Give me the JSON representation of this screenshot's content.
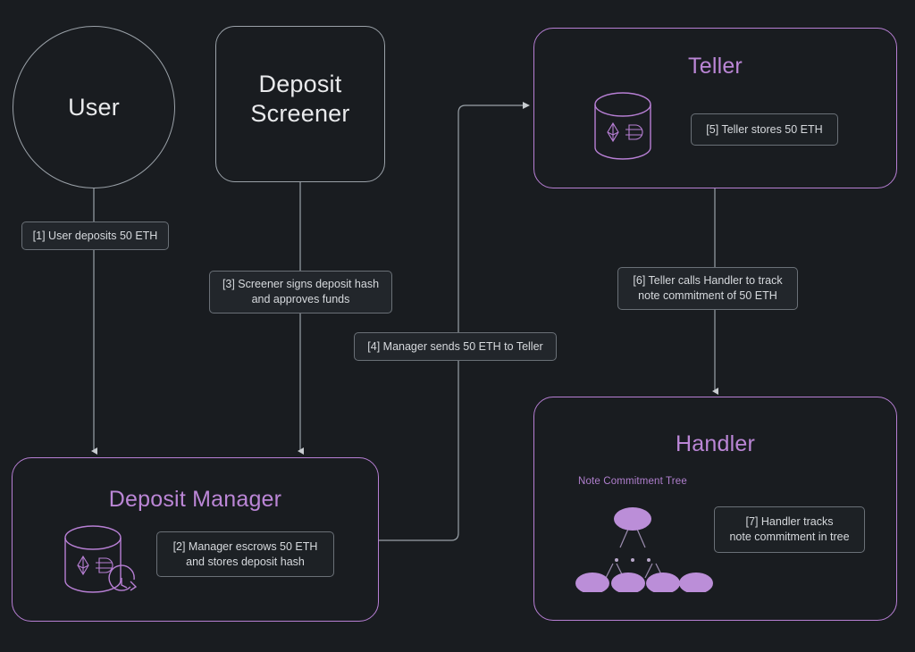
{
  "diagram": {
    "background_color": "#191c20",
    "accent_purple": "#b77fd4",
    "title_purple": "#bb86d6",
    "grey_stroke": "#9aa1a8",
    "nodes": [
      {
        "id": "user",
        "label": "User",
        "shape": "circle",
        "style": "grey"
      },
      {
        "id": "deposit-screener",
        "label": "Deposit\nScreener",
        "shape": "rounded-rect",
        "style": "grey"
      },
      {
        "id": "teller",
        "label": "Teller",
        "shape": "rounded-rect",
        "style": "purple"
      },
      {
        "id": "deposit-manager",
        "label": "Deposit Manager",
        "shape": "rounded-rect",
        "style": "purple"
      },
      {
        "id": "handler",
        "label": "Handler",
        "shape": "rounded-rect",
        "style": "purple"
      }
    ],
    "node_labels": {
      "user": "User",
      "deposit_screener_line1": "Deposit",
      "deposit_screener_line2": "Screener",
      "teller": "Teller",
      "deposit_manager": "Deposit Manager",
      "handler": "Handler"
    },
    "edge_labels": [
      {
        "step": 1,
        "text": "[1] User deposits 50 ETH",
        "from": "user",
        "to": "deposit-manager"
      },
      {
        "step": 2,
        "text": "[2] Manager escrows 50 ETH\nand stores deposit hash",
        "from": "deposit-manager",
        "to": "deposit-manager"
      },
      {
        "step": 3,
        "text": "[3] Screener signs deposit hash\nand approves funds",
        "from": "deposit-screener",
        "to": "deposit-manager"
      },
      {
        "step": 4,
        "text": "[4] Manager sends 50 ETH to Teller",
        "from": "deposit-manager",
        "to": "teller"
      },
      {
        "step": 5,
        "text": "[5] Teller stores 50 ETH",
        "from": "teller",
        "to": "teller"
      },
      {
        "step": 6,
        "text": "[6] Teller calls Handler to track\nnote commitment of 50 ETH",
        "from": "teller",
        "to": "handler"
      },
      {
        "step": 7,
        "text": "[7] Handler tracks\nnote commitment in tree",
        "from": "handler",
        "to": "handler"
      }
    ],
    "label_1": "[1] User deposits 50 ETH",
    "label_2": "[2] Manager escrows 50 ETH\nand stores deposit hash",
    "label_3": "[3] Screener signs deposit hash\nand approves funds",
    "label_4": "[4] Manager sends 50 ETH to Teller",
    "label_5": "[5] Teller stores 50 ETH",
    "label_6": "[6] Teller calls Handler to track\nnote commitment of 50 ETH",
    "label_7": "[7] Handler tracks\nnote commitment in tree",
    "tree": {
      "caption": "Note Commitment Tree",
      "root_nodes": 1,
      "leaf_nodes": 4,
      "ellipsis_dots": 3,
      "node_fill": "#bb8ed8"
    },
    "icons": {
      "teller_vault": "database-cylinder-icon",
      "manager_vault": "database-cylinder-clock-icon",
      "token_eth": "ethereum-icon",
      "token_dai": "dai-icon",
      "clock": "clock-icon"
    }
  }
}
